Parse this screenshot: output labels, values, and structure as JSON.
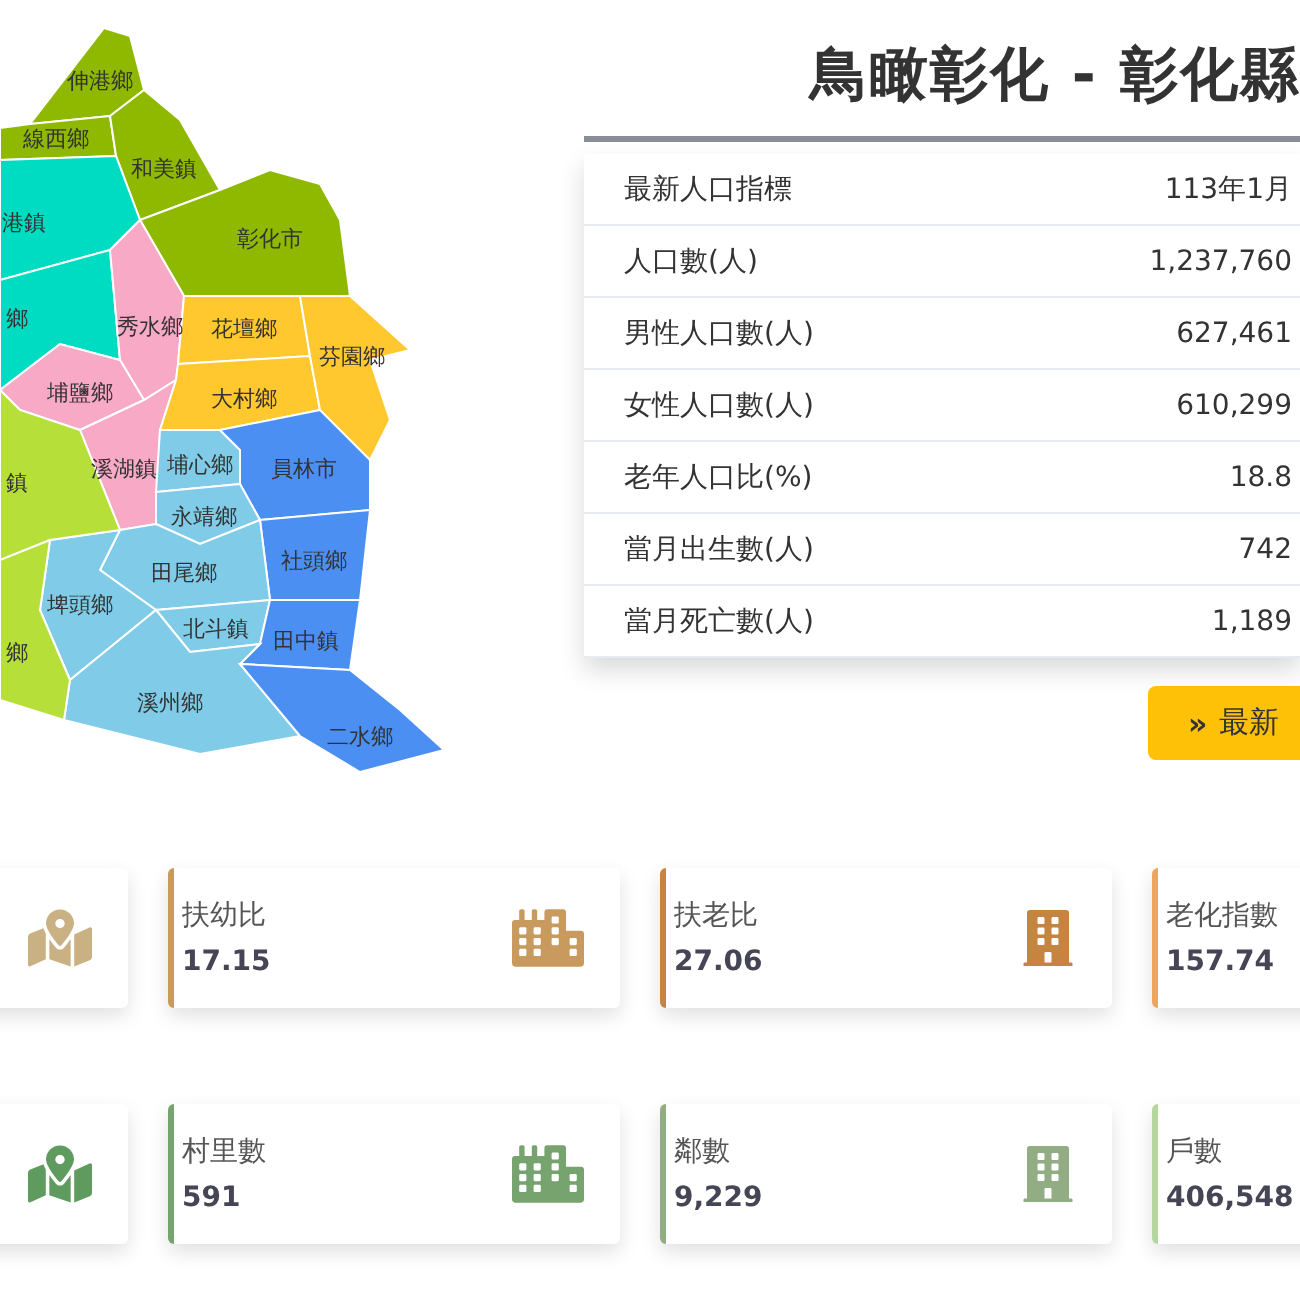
{
  "map": {
    "regions": [
      {
        "label": "伸港鄉",
        "color": "#8fb800"
      },
      {
        "label": "線西鄉",
        "color": "#8fb800"
      },
      {
        "label": "和美鎮",
        "color": "#8fb800"
      },
      {
        "label": "彰化市",
        "color": "#8fb800"
      },
      {
        "label": "港鎮",
        "color": "#00dcc2"
      },
      {
        "label": "鄉",
        "color": "#00dcc2"
      },
      {
        "label": "秀水鄉",
        "color": "#f8a9c6"
      },
      {
        "label": "埔鹽鄉",
        "color": "#f8a9c6"
      },
      {
        "label": "溪湖鎮",
        "color": "#f8a9c6"
      },
      {
        "label": "花壇鄉",
        "color": "#ffc82e"
      },
      {
        "label": "大村鄉",
        "color": "#ffc82e"
      },
      {
        "label": "芬園鄉",
        "color": "#ffc82e"
      },
      {
        "label": "埔心鄉",
        "color": "#80cce8"
      },
      {
        "label": "員林市",
        "color": "#4b8ff2"
      },
      {
        "label": "永靖鄉",
        "color": "#80cce8"
      },
      {
        "label": "社頭鄉",
        "color": "#4b8ff2"
      },
      {
        "label": "田尾鄉",
        "color": "#80cce8"
      },
      {
        "label": "埤頭鄉",
        "color": "#80cce8"
      },
      {
        "label": "北斗鎮",
        "color": "#80cce8"
      },
      {
        "label": "田中鎮",
        "color": "#4b8ff2"
      },
      {
        "label": "溪州鄉",
        "color": "#80cce8"
      },
      {
        "label": "二水鄉",
        "color": "#4b8ff2"
      },
      {
        "label": "鎮",
        "color": "#b6df3a"
      },
      {
        "label": "鄉",
        "color": "#b6df3a"
      }
    ]
  },
  "title": "鳥瞰彰化 - 彰化縣",
  "stats": [
    {
      "label": "最新人口指標",
      "value": "113年1月"
    },
    {
      "label": "人口數(人)",
      "value": "1,237,760"
    },
    {
      "label": "男性人口數(人)",
      "value": "627,461"
    },
    {
      "label": "女性人口數(人)",
      "value": "610,299"
    },
    {
      "label": "老年人口比(%)",
      "value": "18.8"
    },
    {
      "label": "當月出生數(人)",
      "value": "742"
    },
    {
      "label": "當月死亡數(人)",
      "value": "1,189"
    }
  ],
  "more_button": {
    "icon": "»",
    "label": "最新"
  },
  "card_rows": [
    {
      "cards": [
        {
          "kind": "map",
          "color": "#c9b183"
        },
        {
          "kind": "city",
          "label": "扶幼比",
          "value": "17.15",
          "color": "#c99a5e"
        },
        {
          "kind": "building",
          "label": "扶老比",
          "value": "27.06",
          "color": "#c5843f"
        },
        {
          "label": "老化指數",
          "value": "157.74",
          "color": "#f2a45a"
        }
      ]
    },
    {
      "cards": [
        {
          "kind": "map",
          "color": "#5f9b5e"
        },
        {
          "kind": "city",
          "label": "村里數",
          "value": "591",
          "color": "#77a36f"
        },
        {
          "kind": "building",
          "label": "鄰數",
          "value": "9,229",
          "color": "#92ad83"
        },
        {
          "label": "戶數",
          "value": "406,548",
          "color": "#b5d69e"
        }
      ]
    }
  ]
}
